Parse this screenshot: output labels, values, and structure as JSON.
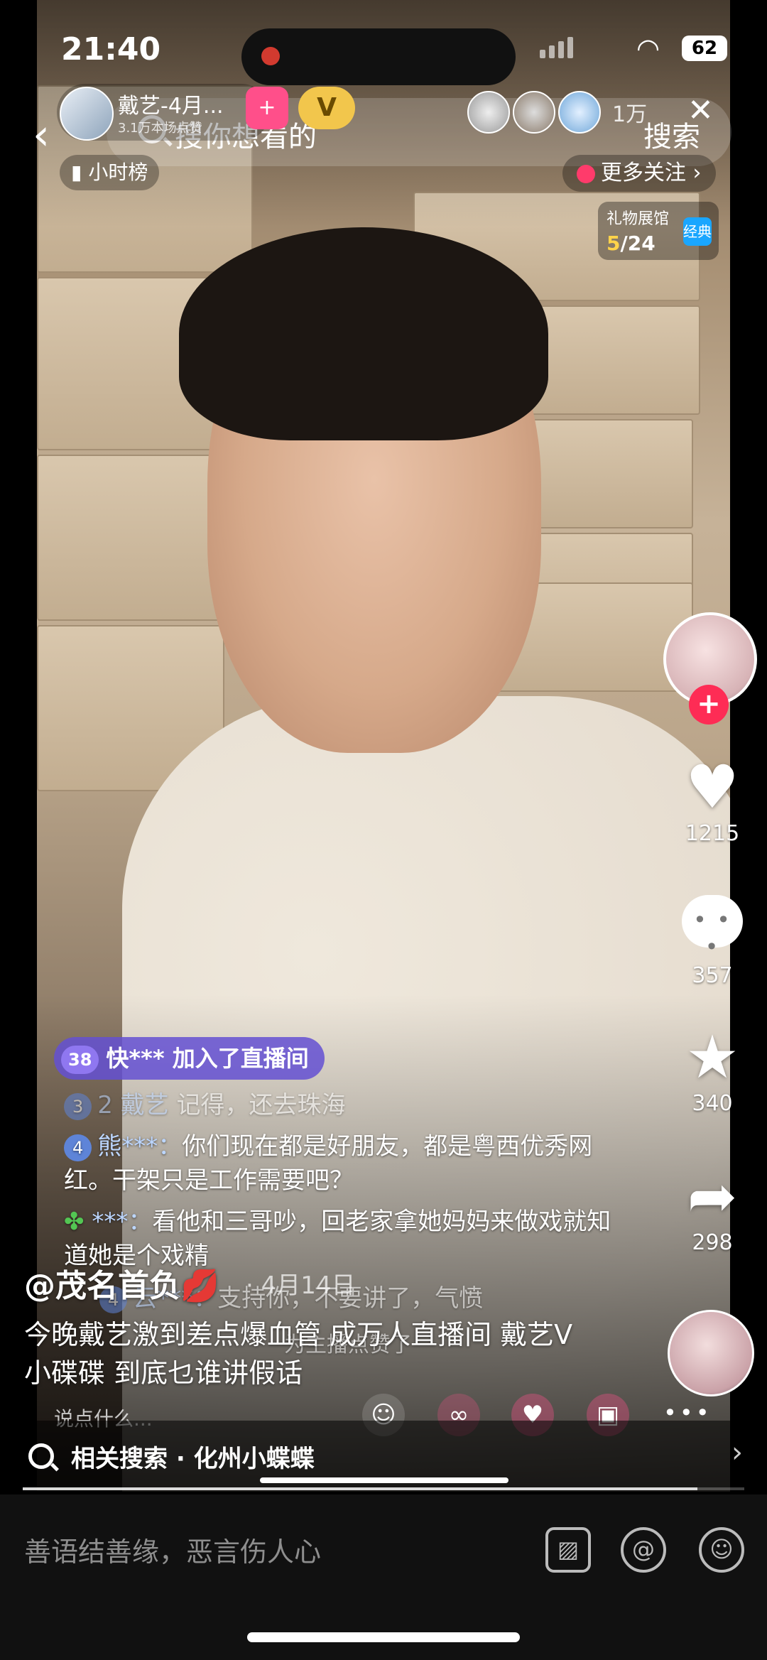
{
  "status": {
    "time": "21:40",
    "battery": "62"
  },
  "header": {
    "host_name": "戴艺-4月...",
    "host_sub": "3.1万本场点赞",
    "viewer_count": "1万",
    "search_placeholder": "搜你想看的",
    "search_button": "搜索",
    "rank_label": "小时榜",
    "more_follow": "更多关注",
    "gift_hall_title": "礼物展馆",
    "gift_hall_progress_current": "5",
    "gift_hall_progress_total": "/24",
    "gift_hall_icon": "经典"
  },
  "rail": {
    "likes": "1215",
    "comments": "357",
    "favorites": "340",
    "shares": "298"
  },
  "chat": {
    "joined_level": "38",
    "joined_text": "快*** 加入了直播间",
    "msg1": {
      "level": "3",
      "user": "2 戴艺",
      "text": "记得，还去珠海"
    },
    "msg2": {
      "level": "4",
      "user": "熊***：",
      "text": "你们现在都是好朋友，都是粤西优秀网红。干架只是工作需要吧？"
    },
    "msg3": {
      "user": "***：",
      "text": "看他和三哥吵，回老家拿她妈妈来做戏就知道她是个戏精"
    },
    "msg4": {
      "level": "4",
      "user": "云***：",
      "text": "支持你，不要讲了，气愤"
    },
    "msg5": {
      "text": "为主播点赞了"
    }
  },
  "caption": {
    "author": "@茂名首负💋",
    "date": "· 4月14日",
    "text": "今晚戴艺激到差点爆血管 成万人直播间 戴艺V小碟碟 到底乜谁讲假话",
    "say_placeholder": "说点什么..."
  },
  "related": {
    "label": "相关搜索 · 化州小蝶蝶"
  },
  "comment_bar": {
    "placeholder": "善语结善缘，恶言伤人心"
  }
}
